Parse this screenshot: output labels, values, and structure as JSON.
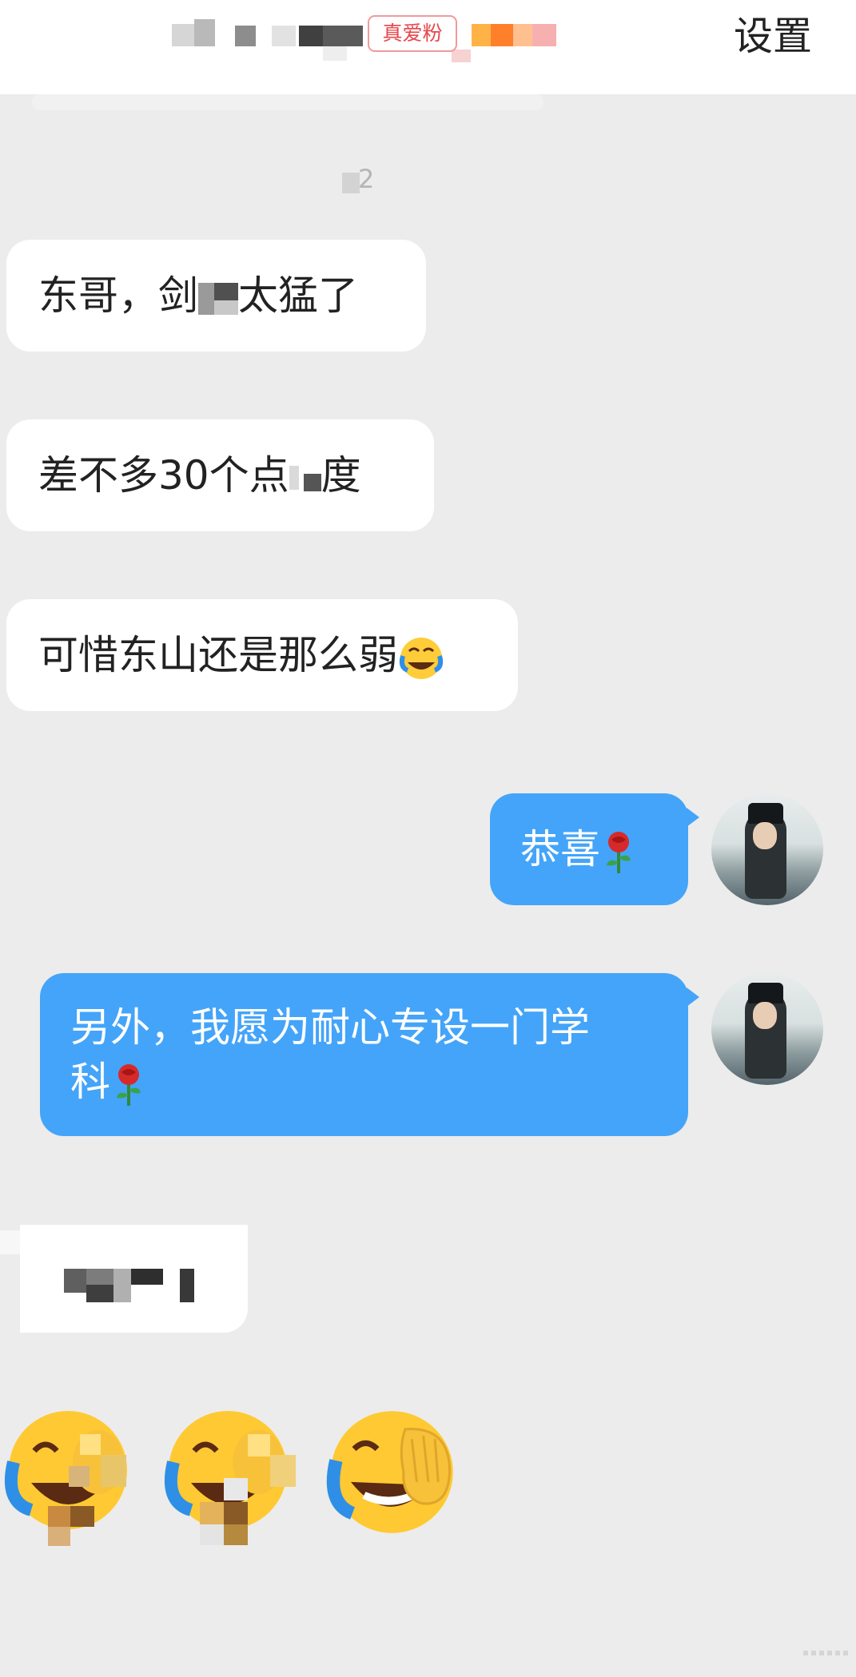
{
  "header": {
    "badge_label": "真爱粉",
    "settings_label": "设置"
  },
  "timestamp": "2",
  "messages": [
    {
      "side": "in",
      "text": "东哥，剑",
      "text_after": "太猛了"
    },
    {
      "side": "in",
      "text": "差不多30个点",
      "text_after": "度"
    },
    {
      "side": "in",
      "text": "可惜东山还是那么弱",
      "emoji": "face-with-tears-of-joy"
    },
    {
      "side": "out",
      "text": "恭喜",
      "emoji": "rose"
    },
    {
      "side": "out",
      "line1": "另外，我愿为耐心专设一门学",
      "line2": "科",
      "emoji": "rose"
    }
  ],
  "colors": {
    "background": "#ececec",
    "outgoing_bubble": "#44a4f9",
    "incoming_bubble": "#ffffff",
    "badge": "#e6474b"
  },
  "icons": [
    "rose-icon",
    "laughing-crying-emoji-icon",
    "avatar"
  ]
}
